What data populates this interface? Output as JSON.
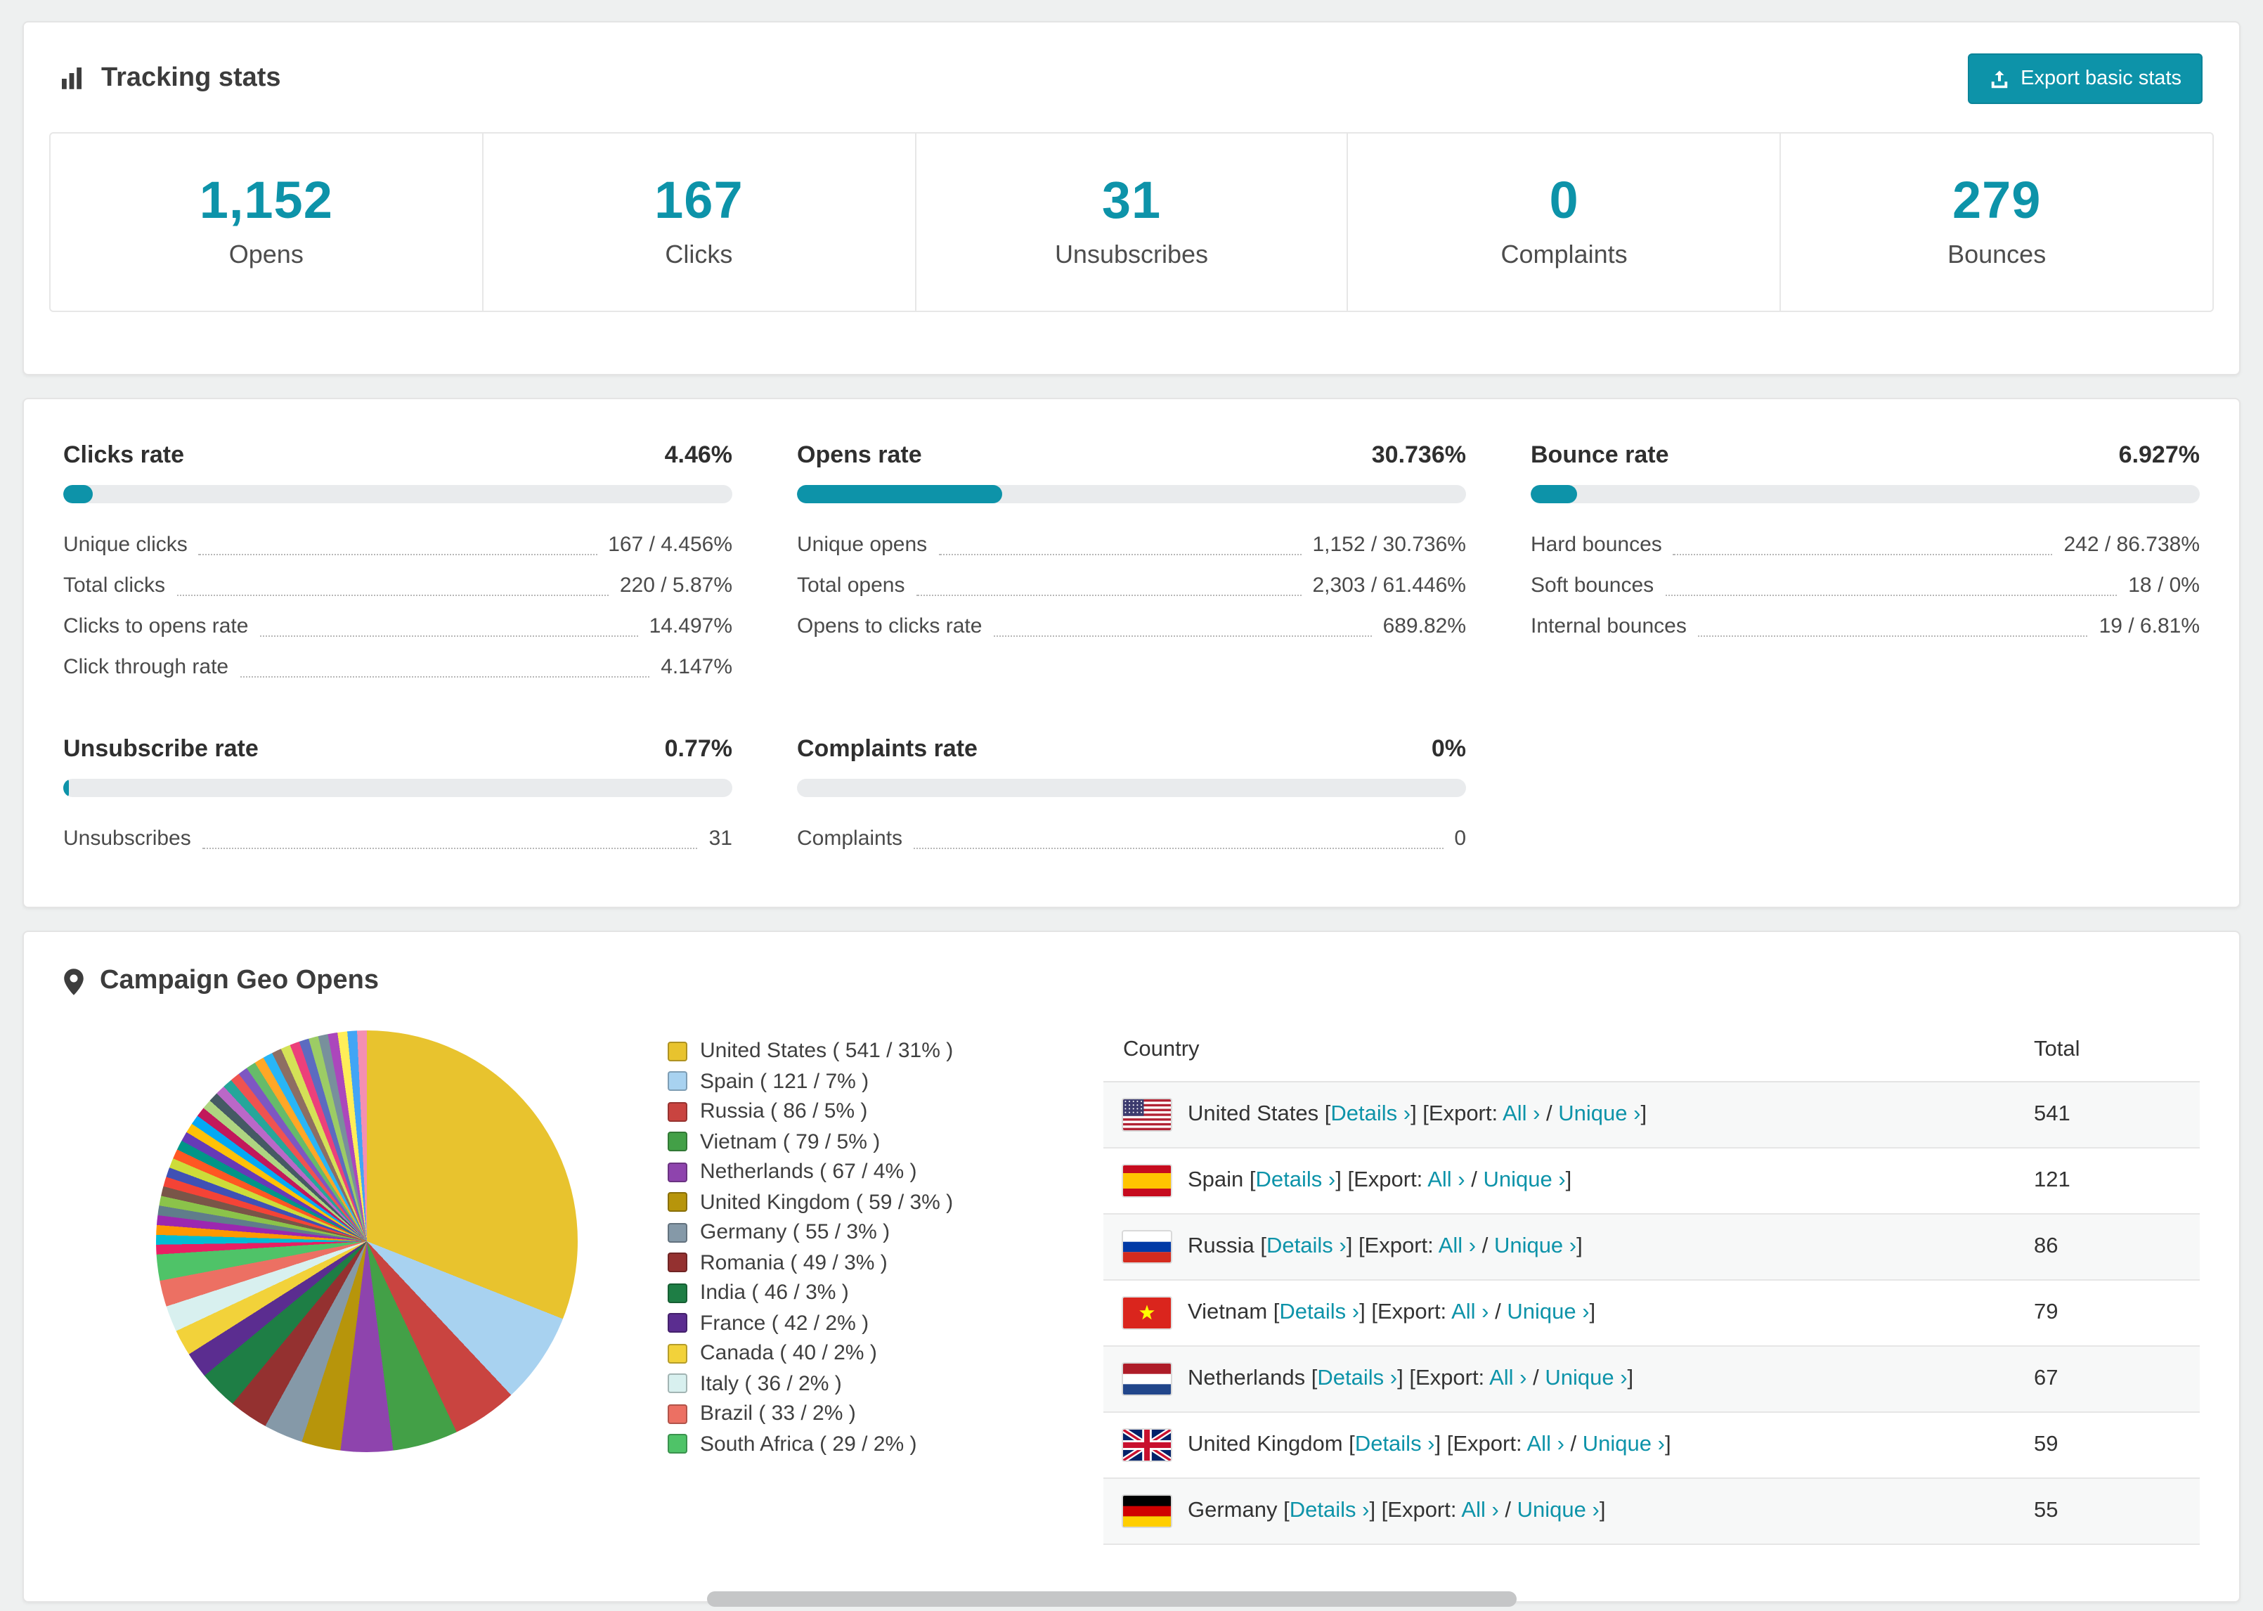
{
  "theme": {
    "accent": "#0d93a9",
    "bar_track": "#e9ebed",
    "page_bg": "#eef0f0"
  },
  "tracking": {
    "title": "Tracking stats",
    "export_button": "Export basic stats",
    "stats": [
      {
        "value": "1,152",
        "label": "Opens"
      },
      {
        "value": "167",
        "label": "Clicks"
      },
      {
        "value": "31",
        "label": "Unsubscribes"
      },
      {
        "value": "0",
        "label": "Complaints"
      },
      {
        "value": "279",
        "label": "Bounces"
      }
    ]
  },
  "rates": {
    "blocks": [
      {
        "title": "Clicks rate",
        "value": "4.46%",
        "percent": 4.46,
        "rows": [
          {
            "label": "Unique clicks",
            "value": "167 / 4.456%"
          },
          {
            "label": "Total clicks",
            "value": "220 / 5.87%"
          },
          {
            "label": "Clicks to opens rate",
            "value": "14.497%"
          },
          {
            "label": "Click through rate",
            "value": "4.147%"
          }
        ]
      },
      {
        "title": "Opens rate",
        "value": "30.736%",
        "percent": 30.736,
        "rows": [
          {
            "label": "Unique opens",
            "value": "1,152 / 30.736%"
          },
          {
            "label": "Total opens",
            "value": "2,303 / 61.446%"
          },
          {
            "label": "Opens to clicks rate",
            "value": "689.82%"
          }
        ]
      },
      {
        "title": "Bounce rate",
        "value": "6.927%",
        "percent": 6.927,
        "rows": [
          {
            "label": "Hard bounces",
            "value": "242 / 86.738%"
          },
          {
            "label": "Soft bounces",
            "value": "18 / 0%"
          },
          {
            "label": "Internal bounces",
            "value": "19 / 6.81%"
          }
        ]
      },
      {
        "title": "Unsubscribe rate",
        "value": "0.77%",
        "percent": 0.77,
        "rows": [
          {
            "label": "Unsubscribes",
            "value": "31"
          }
        ]
      },
      {
        "title": "Complaints rate",
        "value": "0%",
        "percent": 0,
        "rows": [
          {
            "label": "Complaints",
            "value": "0"
          }
        ]
      }
    ]
  },
  "geo": {
    "title": "Campaign Geo Opens",
    "table": {
      "headers": [
        "Country",
        "Total"
      ],
      "details_label": "Details",
      "export_label": "Export:",
      "all_label": "All",
      "unique_label": "Unique",
      "rows": [
        {
          "country": "United States",
          "flag": "us",
          "total": "541"
        },
        {
          "country": "Spain",
          "flag": "es",
          "total": "121"
        },
        {
          "country": "Russia",
          "flag": "ru",
          "total": "86"
        },
        {
          "country": "Vietnam",
          "flag": "vn",
          "total": "79"
        },
        {
          "country": "Netherlands",
          "flag": "nl",
          "total": "67"
        },
        {
          "country": "United Kingdom",
          "flag": "gb",
          "total": "59"
        },
        {
          "country": "Germany",
          "flag": "de",
          "total": "55"
        }
      ]
    }
  },
  "chart_data": {
    "type": "pie",
    "title": "Campaign Geo Opens",
    "labels": [
      "United States",
      "Spain",
      "Russia",
      "Vietnam",
      "Netherlands",
      "United Kingdom",
      "Germany",
      "Romania",
      "India",
      "France",
      "Canada",
      "Italy",
      "Brazil",
      "South Africa"
    ],
    "values": [
      541,
      121,
      86,
      79,
      67,
      59,
      55,
      49,
      46,
      42,
      40,
      36,
      33,
      29
    ],
    "percents": [
      31,
      7,
      5,
      5,
      4,
      3,
      3,
      3,
      3,
      2,
      2,
      2,
      2,
      2
    ],
    "colors": [
      "#e8c32e",
      "#a8d2f0",
      "#c94440",
      "#43a047",
      "#8e44ad",
      "#b7950b",
      "#8599a8",
      "#943130",
      "#1e7e45",
      "#5b2d90",
      "#f2d23a",
      "#d8f0ef",
      "#ec7063",
      "#4fc368"
    ],
    "others_percent": 26,
    "others_slice_count": 35,
    "others_palette": [
      "#e91e63",
      "#00bcd4",
      "#ff9800",
      "#9c27b0",
      "#607d8b",
      "#8bc34a",
      "#795548",
      "#f44336",
      "#3f51b5",
      "#cddc39",
      "#ff5722",
      "#009688",
      "#673ab7",
      "#ffc107",
      "#03a9f4",
      "#c2185b",
      "#aed581",
      "#455a64",
      "#ba68c8",
      "#26a69a",
      "#ef5350",
      "#7e57c2",
      "#66bb6a",
      "#ffa726",
      "#29b6f6",
      "#8d6e63",
      "#d4e157",
      "#ec407a",
      "#5c6bc0",
      "#9ccc65",
      "#78909c",
      "#ab47bc",
      "#ffee58",
      "#42a5f5",
      "#f48fb1"
    ],
    "legend_position": "right"
  }
}
